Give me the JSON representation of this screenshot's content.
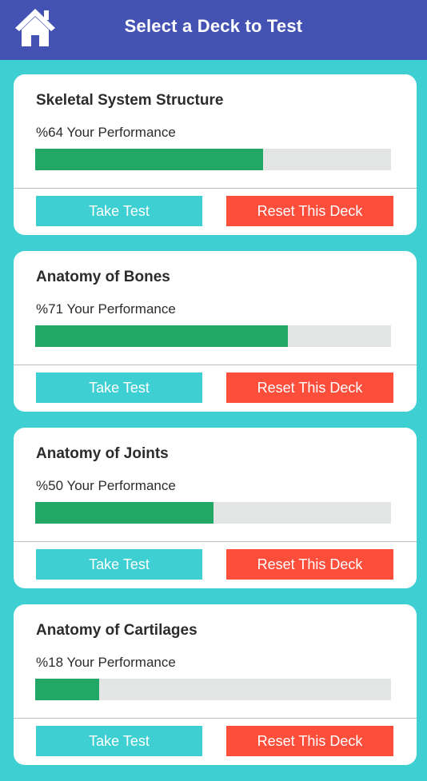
{
  "header": {
    "title": "Select a Deck to Test",
    "home_icon": "home-icon"
  },
  "colors": {
    "header_bg": "#4453b3",
    "page_bg": "#3ecfd2",
    "progress_fill": "#22a765",
    "progress_track": "#e3e4e4",
    "take_test": "#3ecfd2",
    "reset": "#fc4e3b"
  },
  "decks": [
    {
      "title": "Skeletal System Structure",
      "performance_label": "%64 Your Performance",
      "performance": 64,
      "take_test_label": "Take Test",
      "reset_label": "Reset This Deck"
    },
    {
      "title": "Anatomy of Bones",
      "performance_label": "%71 Your Performance",
      "performance": 71,
      "take_test_label": "Take Test",
      "reset_label": "Reset This Deck"
    },
    {
      "title": "Anatomy of Joints",
      "performance_label": "%50 Your Performance",
      "performance": 50,
      "take_test_label": "Take Test",
      "reset_label": "Reset This Deck"
    },
    {
      "title": "Anatomy of Cartilages",
      "performance_label": "%18 Your Performance",
      "performance": 18,
      "take_test_label": "Take Test",
      "reset_label": "Reset This Deck"
    }
  ]
}
